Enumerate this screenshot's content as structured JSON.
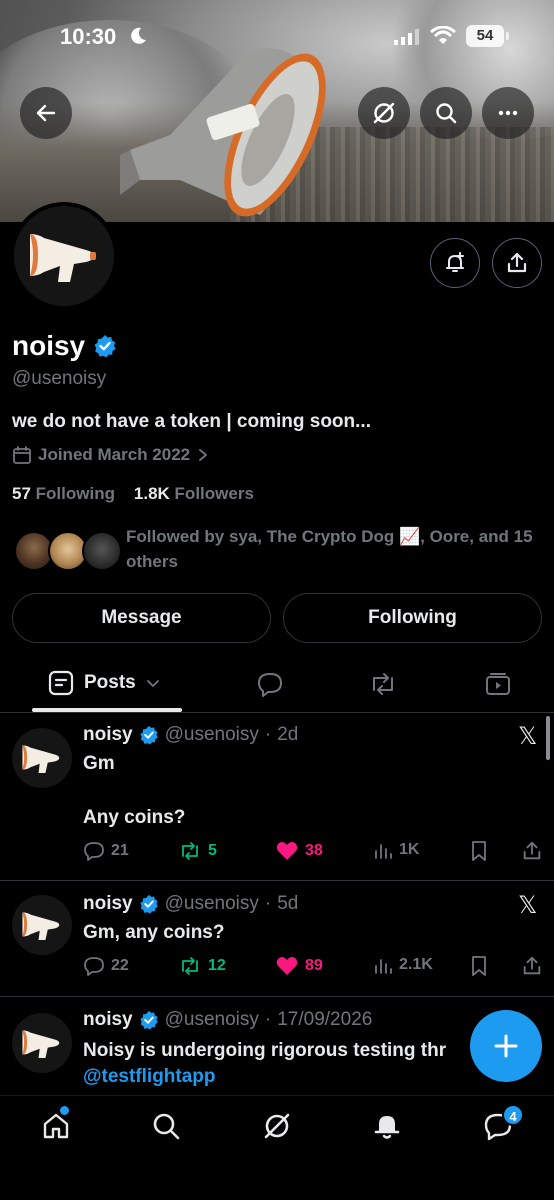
{
  "status_bar": {
    "time": "10:30",
    "battery": "54"
  },
  "profile": {
    "name": "noisy",
    "handle": "@usenoisy",
    "bio": "we do not have a token | coming soon...",
    "joined": "Joined March 2022",
    "following_count": "57",
    "following_label": "Following",
    "followers_count": "1.8K",
    "followers_label": "Followers",
    "followed_by": "Followed by sya, The Crypto Dog 📈, Oore, and 15 others"
  },
  "buttons": {
    "message": "Message",
    "following": "Following"
  },
  "tabs": {
    "posts": "Posts"
  },
  "posts": [
    {
      "name": "noisy",
      "handle": "@usenoisy",
      "sep": "·",
      "time": "2d",
      "text": "Gm\n\nAny coins?",
      "replies": "21",
      "reposts": "5",
      "likes": "38",
      "views": "1K"
    },
    {
      "name": "noisy",
      "handle": "@usenoisy",
      "sep": "·",
      "time": "5d",
      "text": "Gm, any coins?",
      "replies": "22",
      "reposts": "12",
      "likes": "89",
      "views": "2.1K"
    },
    {
      "name": "noisy",
      "handle": "@usenoisy",
      "sep": "·",
      "time": "17/09/2026",
      "text": "Noisy is undergoing rigorous testing thr",
      "mention": "@testflightapp"
    }
  ],
  "nav": {
    "messages_badge": "4"
  },
  "colors": {
    "accent": "#1d9bf0",
    "repost": "#00ba7c",
    "like": "#f91880",
    "muted": "#71767b"
  }
}
